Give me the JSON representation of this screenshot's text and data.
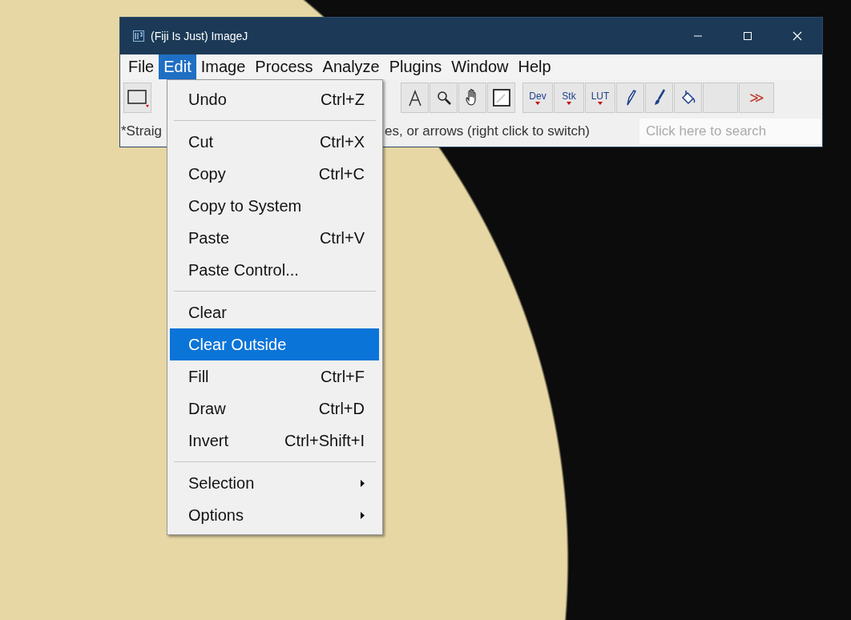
{
  "window": {
    "title": "(Fiji Is Just) ImageJ"
  },
  "menu_bar": [
    {
      "label": "File",
      "selected": false
    },
    {
      "label": "Edit",
      "selected": true
    },
    {
      "label": "Image",
      "selected": false
    },
    {
      "label": "Process",
      "selected": false
    },
    {
      "label": "Analyze",
      "selected": false
    },
    {
      "label": "Plugins",
      "selected": false
    },
    {
      "label": "Window",
      "selected": false
    },
    {
      "label": "Help",
      "selected": false
    }
  ],
  "toolbar": {
    "right_tools": [
      {
        "kind": "text"
      },
      {
        "kind": "magnifier"
      },
      {
        "kind": "hand"
      },
      {
        "kind": "dropper"
      },
      {
        "kind": "gap"
      },
      {
        "kind": "dev",
        "label": "Dev"
      },
      {
        "kind": "stk",
        "label": "Stk"
      },
      {
        "kind": "lut",
        "label": "LUT"
      },
      {
        "kind": "pencil"
      },
      {
        "kind": "brush"
      },
      {
        "kind": "bucket"
      },
      {
        "kind": "empty"
      },
      {
        "kind": "more",
        "label": "≫"
      }
    ]
  },
  "status": {
    "visible_parts": [
      "*Straig",
      "es, or arrows (right click to switch)"
    ],
    "search": {
      "placeholder": "Click here to search"
    }
  },
  "edit_menu": [
    {
      "kind": "item",
      "label": "Undo",
      "shortcut": "Ctrl+Z",
      "submenu": false,
      "selected": false
    },
    {
      "kind": "separator"
    },
    {
      "kind": "item",
      "label": "Cut",
      "shortcut": "Ctrl+X",
      "submenu": false,
      "selected": false
    },
    {
      "kind": "item",
      "label": "Copy",
      "shortcut": "Ctrl+C",
      "submenu": false,
      "selected": false
    },
    {
      "kind": "item",
      "label": "Copy to System",
      "submenu": false,
      "selected": false
    },
    {
      "kind": "item",
      "label": "Paste",
      "shortcut": "Ctrl+V",
      "submenu": false,
      "selected": false
    },
    {
      "kind": "item",
      "label": "Paste Control...",
      "submenu": false,
      "selected": false
    },
    {
      "kind": "separator"
    },
    {
      "kind": "item",
      "label": "Clear",
      "submenu": false,
      "selected": false
    },
    {
      "kind": "item",
      "label": "Clear Outside",
      "submenu": false,
      "selected": true
    },
    {
      "kind": "item",
      "label": "Fill",
      "shortcut": "Ctrl+F",
      "submenu": false,
      "selected": false
    },
    {
      "kind": "item",
      "label": "Draw",
      "shortcut": "Ctrl+D",
      "submenu": false,
      "selected": false
    },
    {
      "kind": "item",
      "label": "Invert",
      "shortcut": "Ctrl+Shift+I",
      "submenu": false,
      "selected": false
    },
    {
      "kind": "separator"
    },
    {
      "kind": "item",
      "label": "Selection",
      "submenu": true,
      "selected": false
    },
    {
      "kind": "item",
      "label": "Options",
      "submenu": true,
      "selected": false
    }
  ]
}
